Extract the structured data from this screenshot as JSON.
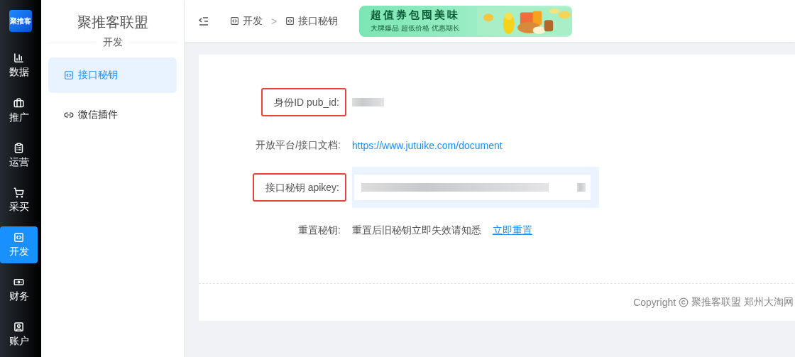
{
  "rail": {
    "logo_text": "聚推客",
    "items": [
      {
        "label": "数据",
        "kind": "chart",
        "selected": false
      },
      {
        "label": "推广",
        "kind": "briefcase",
        "selected": false
      },
      {
        "label": "运营",
        "kind": "clipboard",
        "selected": false
      },
      {
        "label": "采买",
        "kind": "cart",
        "selected": false
      },
      {
        "label": "开发",
        "kind": "code",
        "selected": true
      },
      {
        "label": "财务",
        "kind": "money",
        "selected": false
      },
      {
        "label": "账户",
        "kind": "user",
        "selected": false
      }
    ]
  },
  "sidebar": {
    "title": "聚推客联盟",
    "section": "开发",
    "items": [
      {
        "label": "接口秘钥",
        "kind": "code",
        "selected": true
      },
      {
        "label": "微信插件",
        "kind": "link",
        "selected": false
      }
    ]
  },
  "header": {
    "breadcrumb": [
      {
        "label": "开发"
      },
      {
        "label": "接口秘钥"
      }
    ],
    "separator": ">",
    "banner": {
      "title": "超值券包囤美味",
      "subtitle": "大牌爆品 超低价格 优惠期长"
    }
  },
  "form": [
    {
      "kind": "masked",
      "label": "身份ID pub_id:",
      "highlighted": true
    },
    {
      "kind": "link",
      "label": "开放平台/接口文档:",
      "highlighted": false,
      "value": "https://www.jutuike.com/document"
    },
    {
      "kind": "field",
      "label": "接口秘钥 apikey:",
      "highlighted": true
    },
    {
      "kind": "reset",
      "label": "重置秘钥:",
      "highlighted": false,
      "value": "重置后旧秘钥立即失效请知悉",
      "action": "立即重置"
    }
  ],
  "footer": {
    "copyright": "Copyright",
    "text": "聚推客联盟 郑州大淘网"
  }
}
